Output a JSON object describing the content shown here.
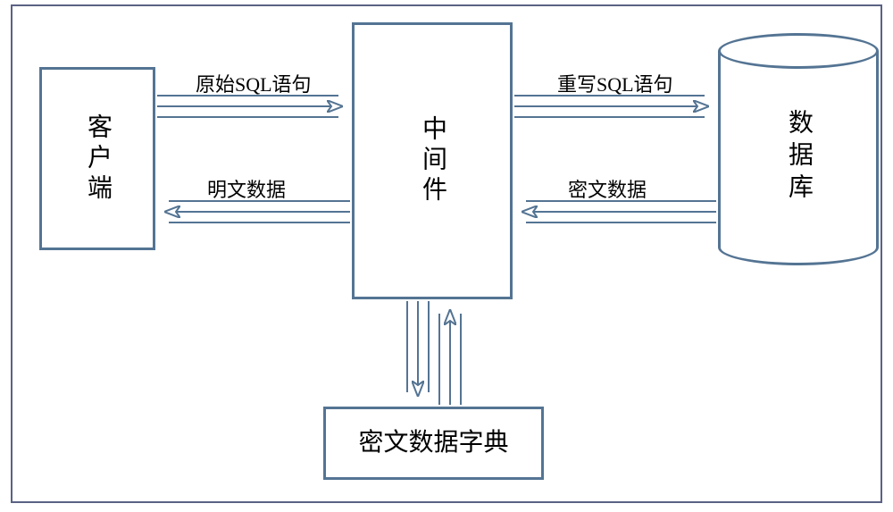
{
  "nodes": {
    "client": "客户端",
    "middleware": "中间件",
    "database": "数据库",
    "dictionary": "密文数据字典"
  },
  "edges": {
    "client_to_middleware": "原始SQL语句",
    "middleware_to_client": "明文数据",
    "middleware_to_database": "重写SQL语句",
    "database_to_middleware": "密文数据"
  }
}
